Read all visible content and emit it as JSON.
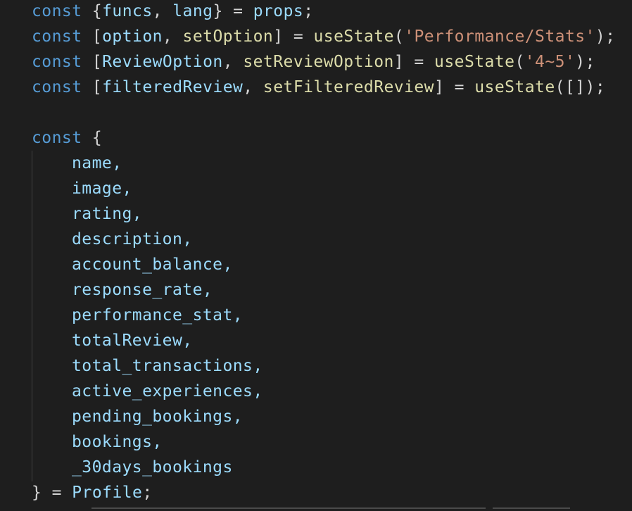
{
  "code": {
    "line1": {
      "kw": "const",
      "open": "{",
      "a": "funcs",
      "comma": ",",
      "b": "lang",
      "close": "}",
      "eq": "=",
      "value": "props",
      "semi": ";"
    },
    "line2": {
      "kw": "const",
      "open": "[",
      "a": "option",
      "comma": ",",
      "b": "setOption",
      "close": "]",
      "eq": "=",
      "fn": "useState",
      "paren_open": "(",
      "str": "'Performance/Stats'",
      "paren_close": ")",
      "semi": ";"
    },
    "line3": {
      "kw": "const",
      "open": "[",
      "a": "ReviewOption",
      "comma": ",",
      "b": "setReviewOption",
      "close": "]",
      "eq": "=",
      "fn": "useState",
      "paren_open": "(",
      "str": "'4~5'",
      "paren_close": ")",
      "semi": ";"
    },
    "line4": {
      "kw": "const",
      "open": "[",
      "a": "filteredReview",
      "comma": ",",
      "b": "setFilteredReview",
      "close": "]",
      "eq": "=",
      "fn": "useState",
      "args": "([])",
      "semi": ";"
    },
    "destructure": {
      "kw": "const",
      "open": "{",
      "fields": [
        "name,",
        "image,",
        "rating,",
        "description,",
        "account_balance,",
        "response_rate,",
        "performance_stat,",
        "totalReview,",
        "total_transactions,",
        "active_experiences,",
        "pending_bookings,",
        "bookings,",
        "_30days_bookings"
      ],
      "close": "}",
      "eq": "=",
      "source": "Profile",
      "semi": ";"
    }
  },
  "colors": {
    "background": "#1e1e1e",
    "keyword": "#569cd6",
    "variable": "#9cdcfe",
    "function": "#dcdcaa",
    "string": "#ce9178",
    "punctuation": "#d4d4d4"
  }
}
